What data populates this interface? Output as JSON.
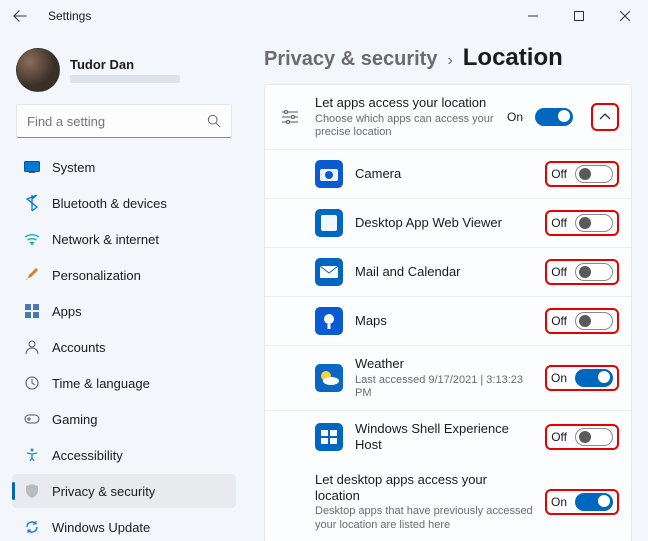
{
  "window": {
    "title": "Settings"
  },
  "profile": {
    "name": "Tudor Dan"
  },
  "search": {
    "placeholder": "Find a setting"
  },
  "nav": {
    "items": [
      {
        "label": "System"
      },
      {
        "label": "Bluetooth & devices"
      },
      {
        "label": "Network & internet"
      },
      {
        "label": "Personalization"
      },
      {
        "label": "Apps"
      },
      {
        "label": "Accounts"
      },
      {
        "label": "Time & language"
      },
      {
        "label": "Gaming"
      },
      {
        "label": "Accessibility"
      },
      {
        "label": "Privacy & security"
      },
      {
        "label": "Windows Update"
      }
    ]
  },
  "breadcrumb": {
    "parent": "Privacy & security",
    "sep": "›",
    "current": "Location"
  },
  "header_row": {
    "title": "Let apps access your location",
    "subtitle": "Choose which apps can access your precise location",
    "state_label": "On"
  },
  "apps": [
    {
      "name": "Camera",
      "state": "Off",
      "subtitle": ""
    },
    {
      "name": "Desktop App Web Viewer",
      "state": "Off",
      "subtitle": ""
    },
    {
      "name": "Mail and Calendar",
      "state": "Off",
      "subtitle": ""
    },
    {
      "name": "Maps",
      "state": "Off",
      "subtitle": ""
    },
    {
      "name": "Weather",
      "state": "On",
      "subtitle": "Last accessed 9/17/2021 | 3:13:23 PM"
    },
    {
      "name": "Windows Shell Experience Host",
      "state": "Off",
      "subtitle": ""
    }
  ],
  "footer_row": {
    "title": "Let desktop apps access your location",
    "subtitle": "Desktop apps that have previously accessed your location are listed here",
    "state_label": "On"
  }
}
